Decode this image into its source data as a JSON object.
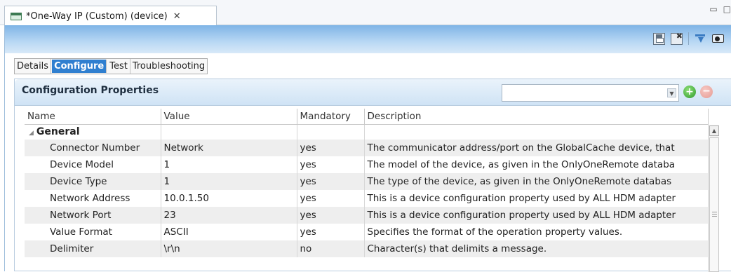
{
  "editor": {
    "tab_label": "*One-Way IP (Custom) (device)",
    "close_glyph": "✕",
    "window_controls": [
      "▭",
      "□"
    ]
  },
  "toolbar": {
    "icons": [
      "save-icon",
      "revert-icon",
      "filter-icon",
      "view-icon"
    ]
  },
  "tabs": [
    {
      "label": "Details",
      "active": false
    },
    {
      "label": "Configure",
      "active": true
    },
    {
      "label": "Test",
      "active": false
    },
    {
      "label": "Troubleshooting",
      "active": false
    }
  ],
  "panel": {
    "title": "Configuration Properties",
    "combo_value": "",
    "add_label": "+",
    "remove_label": "−"
  },
  "table": {
    "headers": [
      "Name",
      "Value",
      "Mandatory",
      "Description"
    ],
    "group": "General",
    "rows": [
      {
        "name": "Connector Number",
        "value": "Network",
        "mandatory": "yes",
        "description": "The communicator address/port on the GlobalCache device, that"
      },
      {
        "name": "Device Model",
        "value": "1",
        "mandatory": "yes",
        "description": "The model of the device, as given in the OnlyOneRemote databa"
      },
      {
        "name": "Device Type",
        "value": "1",
        "mandatory": "yes",
        "description": "The type of the device, as given in the OnlyOneRemote databas"
      },
      {
        "name": "Network Address",
        "value": "10.0.1.50",
        "mandatory": "yes",
        "description": "This is a device configuration property used by ALL HDM adapter"
      },
      {
        "name": "Network Port",
        "value": "23",
        "mandatory": "yes",
        "description": "This is a device configuration property used by ALL HDM adapter"
      },
      {
        "name": "Value Format",
        "value": "ASCII",
        "mandatory": "yes",
        "description": "Specifies the format of the operation property values."
      },
      {
        "name": "Delimiter",
        "value": "\\r\\n",
        "mandatory": "no",
        "description": "Character(s) that delimits a message."
      }
    ]
  }
}
